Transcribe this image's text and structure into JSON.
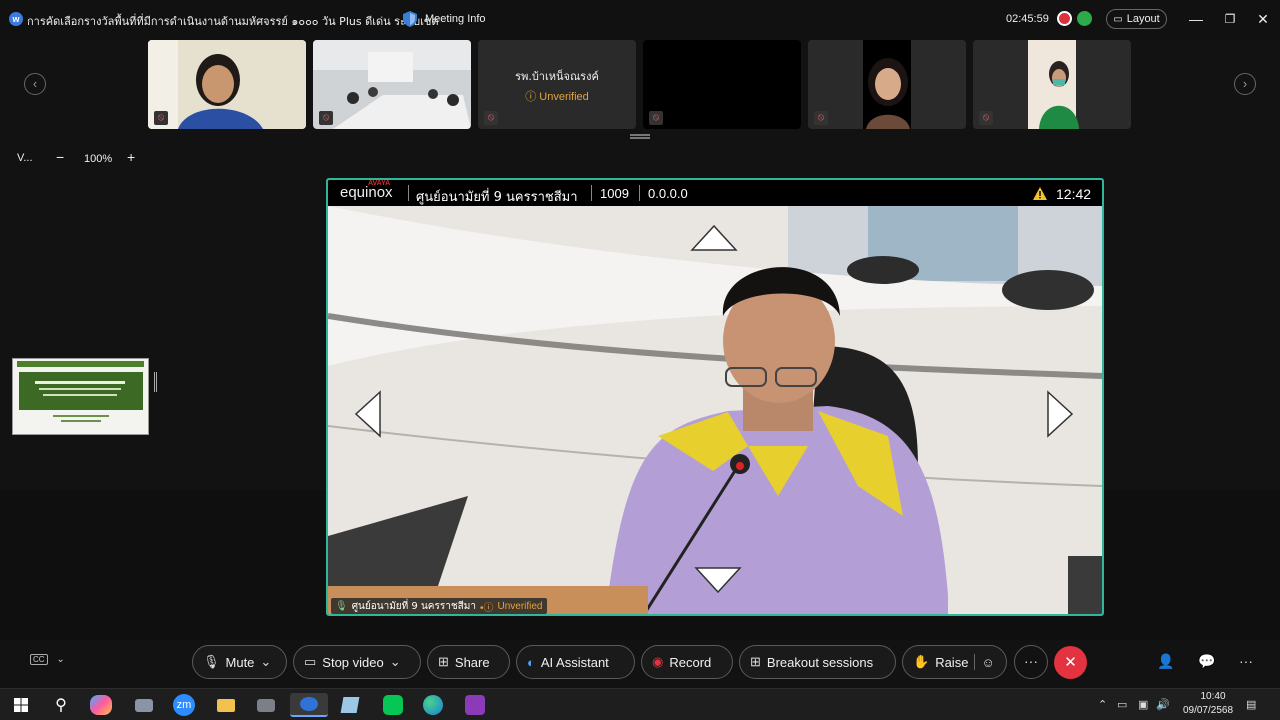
{
  "titlebar": {
    "meeting_title": "การคัดเลือกรางวัลพื้นที่ที่มีการดำเนินงานด้านมหัศจรรย์ ๑๐๐๐ วัน Plus ดีเด่น ระดับเขต",
    "meeting_info_label": "Meeting Info",
    "timer": "02:45:59",
    "layout_label": "Layout",
    "minimize": "—",
    "restore": "❐",
    "close": "✕"
  },
  "strip": {
    "prev": "‹",
    "next": "›",
    "tiles": [
      {
        "name": "",
        "unverified": ""
      },
      {
        "name": "",
        "unverified": ""
      },
      {
        "name": "รพ.บ้าเหน็จณรงค์",
        "unverified": "Unverified"
      },
      {
        "name": "",
        "unverified": ""
      },
      {
        "name": "",
        "unverified": ""
      },
      {
        "name": "",
        "unverified": ""
      }
    ]
  },
  "zoom": {
    "view_label": "V...",
    "minus": "−",
    "value": "100%",
    "plus": "+"
  },
  "main_video": {
    "brand": "equinox",
    "brand_sub": "AVAYA",
    "site": "ศูนย์อนามัยที่ 9 นครราชสีมา",
    "extension": "1009",
    "ip": "0.0.0.0",
    "time": "12:42",
    "footer_site": "ศูนย์อนามัยที่ 9 นครราชสีมา",
    "footer_unverified": "Unverified"
  },
  "toolbar": {
    "mute": "Mute",
    "stop_video": "Stop video",
    "share": "Share",
    "ai_assistant": "AI Assistant",
    "record": "Record",
    "breakout": "Breakout sessions",
    "raise": "Raise",
    "more": "···",
    "leave": "✕"
  },
  "taskbar": {
    "time": "10:40",
    "date": "09/07/2568",
    "apps": [
      "zm"
    ]
  },
  "colors": {
    "accent_border": "#2fb79c",
    "leave": "#e33240",
    "unverified": "#e3a33a"
  }
}
